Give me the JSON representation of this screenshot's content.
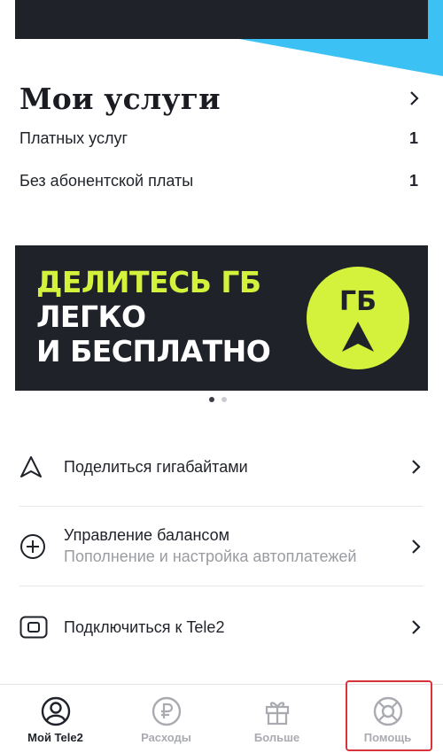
{
  "services": {
    "title": "Мои услуги",
    "rows": [
      {
        "label": "Платных услуг",
        "count": "1"
      },
      {
        "label": "Без абонентской платы",
        "count": "1"
      }
    ]
  },
  "banner": {
    "line1": "ДЕЛИТЕСЬ ГБ",
    "line2": "ЛЕГКО",
    "line3": "И БЕСПЛАТНО",
    "badge": "ГБ",
    "accent_color": "#d4f13c",
    "background_color": "#1f2229"
  },
  "carousel": {
    "pages": 2,
    "active_index": 0
  },
  "menu": [
    {
      "icon": "triangle-arrow-icon",
      "title": "Поделиться гигабайтами",
      "subtitle": ""
    },
    {
      "icon": "plus-circle-icon",
      "title": "Управление балансом",
      "subtitle": "Пополнение и настройка автоплатежей"
    },
    {
      "icon": "sim-card-icon",
      "title": "Подключиться к Tele2",
      "subtitle": ""
    }
  ],
  "tabbar": {
    "tabs": [
      {
        "label": "Мой Tele2",
        "icon": "profile-icon",
        "active": true
      },
      {
        "label": "Расходы",
        "icon": "ruble-icon",
        "active": false
      },
      {
        "label": "Больше",
        "icon": "gift-icon",
        "active": false
      },
      {
        "label": "Помощь",
        "icon": "lifebuoy-icon",
        "active": false
      }
    ],
    "highlight_color": "#d8323a"
  },
  "colors": {
    "accent_blue": "#3bc1f3",
    "text_dark": "#1f2229",
    "text_muted": "#9a9ca1"
  }
}
